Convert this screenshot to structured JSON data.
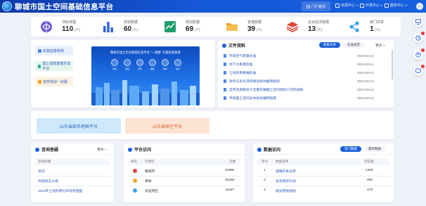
{
  "header": {
    "title": "聊城市国土空间基础信息平台",
    "nav": [
      {
        "label": "门户首页",
        "active": true
      },
      {
        "label": "资源中心",
        "active": false
      },
      {
        "label": "开发中心",
        "active": false
      },
      {
        "label": "服务中心",
        "active": false
      }
    ]
  },
  "stats": [
    {
      "label": "测绘地理",
      "value": "110",
      "unit": "(个)",
      "icon": "globe-icon",
      "color": "#6b5ad6"
    },
    {
      "label": "现状数据",
      "value": "60",
      "unit": "(个)",
      "icon": "bar-chart-icon",
      "color": "#2f63e0"
    },
    {
      "label": "规划数据",
      "value": "69",
      "unit": "(个)",
      "icon": "trend-chart-icon",
      "color": "#1f9e6b"
    },
    {
      "label": "管理数据",
      "value": "39",
      "unit": "(个)",
      "icon": "folder-icon",
      "color": "#f2a329"
    },
    {
      "label": "社会经济数据",
      "value": "13",
      "unit": "(个)",
      "icon": "layers-icon",
      "color": "#e0453a"
    },
    {
      "label": "部门共享",
      "value": "1",
      "unit": "(个)",
      "icon": "share-icon",
      "color": "#3aa0e8"
    }
  ],
  "quick_links": [
    {
      "label": "实施监督系统",
      "color": "#4a86e8"
    },
    {
      "label": "国土调查数据共享平台",
      "color": "#2cb67d"
    },
    {
      "label": "自然资源一张图",
      "color": "#f0a020"
    }
  ],
  "banner": {
    "title": "聊城市国土空间基础信息平台 \"一张图\" 实施监督系统",
    "icons": [
      "测绘",
      "规划",
      "调查",
      "确权",
      "审批",
      "监管"
    ]
  },
  "docs": {
    "title": "文件资料",
    "tabs": [
      "政策文件",
      "标准规范"
    ],
    "more": "更多",
    "rows": [
      {
        "title": "环境空气质量标准",
        "date": "2024-03-14"
      },
      {
        "title": "地下水质量标准",
        "date": "2024-03-14"
      },
      {
        "title": "土地利用数据标准",
        "date": "2024-03-14"
      },
      {
        "title": "政务信息化项目建设规划编制指南",
        "date": "2024-03-14"
      },
      {
        "title": "自然资源部关于全面开展国土空间规划工作的通知",
        "date": "2024-03-14"
      },
      {
        "title": "市级国土空间总体规划编制指南",
        "date": "2024-03-14"
      }
    ]
  },
  "platforms": [
    {
      "label": "山东省政务地图平台",
      "bg": "#cfe8fb",
      "fg": "#2d6fc0"
    },
    {
      "label": "山东省国空平台",
      "bg": "#fde3d3",
      "fg": "#d9642a"
    }
  ],
  "consult": {
    "title": "咨询答疑",
    "more": "更多",
    "header": "咨询标题",
    "rows": [
      "测试",
      "村规划怎么做",
      "2022年土地利用分布现状图是"
    ]
  },
  "visits": {
    "title": "平台访问",
    "more": "更多",
    "headers": [
      "排名",
      "行政区",
      "次数"
    ],
    "rows": [
      {
        "name": "聊城市",
        "count": "34886",
        "color": "#e0453a"
      },
      {
        "name": "莘县",
        "count": "30266",
        "color": "#f2a329"
      },
      {
        "name": "东昌府区",
        "count": "16347",
        "color": "#3aa0e8"
      }
    ]
  },
  "data_access": {
    "title": "数据访问",
    "tabs": [
      "热门数据",
      "最新数据"
    ],
    "headers": [
      "序号",
      "数据名称",
      "浏览量"
    ],
    "rows": [
      {
        "no": "1",
        "name": "城镇开发边界",
        "count": "1405"
      },
      {
        "no": "2",
        "name": "生态保护红线",
        "count": "998"
      },
      {
        "no": "3",
        "name": "建设用地规划",
        "count": "476"
      }
    ]
  }
}
